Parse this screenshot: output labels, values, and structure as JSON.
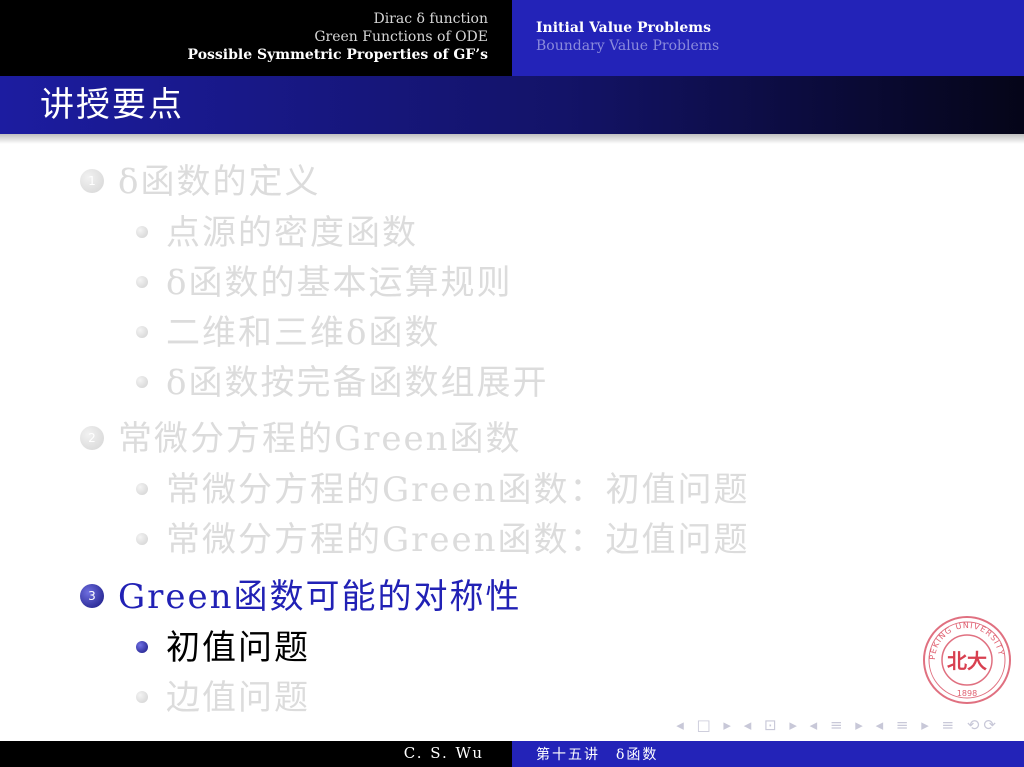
{
  "header": {
    "left_sections": [
      "Dirac δ function",
      "Green Functions of ODE",
      "Possible Symmetric Properties of GF’s"
    ],
    "right_sections": [
      "Initial Value Problems",
      "Boundary Value Problems"
    ]
  },
  "frame": {
    "title": "讲授要点"
  },
  "toc": [
    {
      "number": "1",
      "label": "δ函数的定义",
      "state": "faded",
      "subitems": [
        "点源的密度函数",
        "δ函数的基本运算规则",
        "二维和三维δ函数",
        "δ函数按完备函数组展开"
      ]
    },
    {
      "number": "2",
      "label": "常微分方程的Green函数",
      "state": "faded",
      "subitems": [
        "常微分方程的Green函数：初值问题",
        "常微分方程的Green函数：边值问题"
      ]
    },
    {
      "number": "3",
      "label": "Green函数可能的对称性",
      "state": "current",
      "subitems": [
        "初值问题",
        "边值问题"
      ]
    }
  ],
  "seal": {
    "text": "PEKING UNIVERSITY",
    "year": "1898",
    "emblem": "北大"
  },
  "nav_symbols": "◂ □ ▸ ◂ ⊡ ▸ ◂ ≡ ▸ ◂ ≡ ▸   ≡   ⟲⟳",
  "footer": {
    "author": "C. S. Wu",
    "lecture": "第十五讲　δ函数"
  },
  "colors": {
    "theme_blue": "#2323b8",
    "highlight": "#2121b5",
    "faded": "#dcdcdc",
    "seal_red": "#d84050"
  }
}
